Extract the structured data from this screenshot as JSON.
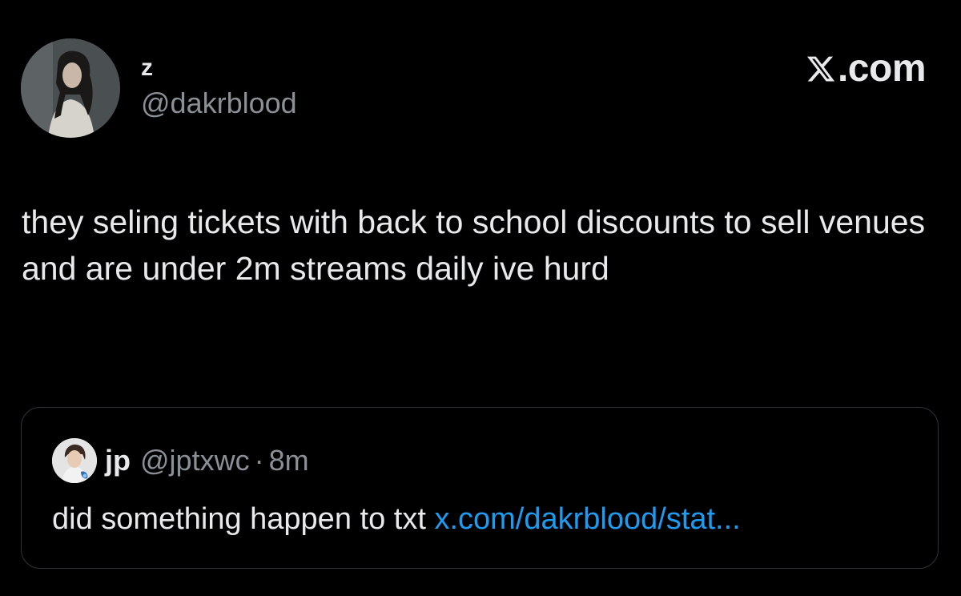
{
  "author": {
    "display_name": "z",
    "handle": "@dakrblood",
    "avatar_icon": "profile-photo"
  },
  "brand": {
    "text": ".com",
    "logo_icon": "x-logo-icon"
  },
  "tweet": {
    "text": "they seling tickets with back to school discounts to sell venues and are under 2m streams daily ive hurd"
  },
  "quote": {
    "display_name": "jp",
    "handle": "@jptxwc",
    "separator": "·",
    "time": "8m",
    "text": "did something happen to txt",
    "link_text": "x.com/dakrblood/stat...",
    "avatar_icon": "profile-photo"
  },
  "colors": {
    "background": "#000000",
    "primary_text": "#e7e9ea",
    "secondary_text": "#8b9096",
    "link": "#1d9bf0",
    "border": "#2f3336"
  }
}
